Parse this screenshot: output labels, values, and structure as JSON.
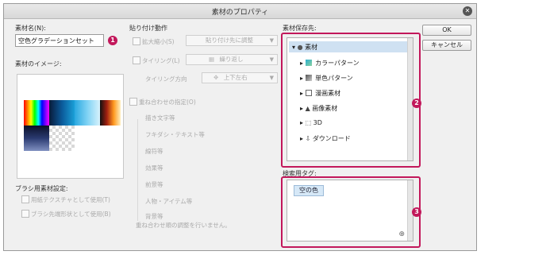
{
  "window": {
    "title": "素材のプロパティ"
  },
  "left": {
    "name_label": "素材名(N):",
    "name_value": "空色グラデーションセット",
    "image_label": "素材のイメージ:",
    "brush_label": "ブラシ用素材設定:",
    "brush_options": [
      "用紙テクスチャとして使用(T)",
      "ブラシ先端形状として使用(B)"
    ]
  },
  "paste": {
    "header": "貼り付け動作",
    "scale_label": "拡大縮小(S)",
    "scale_value": "貼り付け先に調整",
    "tiling_label": "タイリング(L)",
    "tiling_value": "繰り返し",
    "tiling_dir_label": "タイリング方向",
    "tiling_dir_value": "上下左右",
    "overlap_label": "重ね合わせの指定(O)",
    "overlap_items": [
      "描き文字等",
      "フキダシ・テキスト等",
      "線符等",
      "効果等",
      "前景等",
      "人物・アイテム等",
      "背景等"
    ],
    "overlap_note": "重ね合わせ順の調整を行いません。"
  },
  "save": {
    "label": "素材保存先:",
    "tree": [
      {
        "label": "素材",
        "icon": "folder-icon"
      },
      {
        "label": "カラーパターン",
        "icon": "color-pattern-icon"
      },
      {
        "label": "単色パターン",
        "icon": "mono-pattern-icon"
      },
      {
        "label": "漫画素材",
        "icon": "manga-icon"
      },
      {
        "label": "画像素材",
        "icon": "image-icon"
      },
      {
        "label": "3D",
        "icon": "cube-icon"
      },
      {
        "label": "ダウンロード",
        "icon": "download-icon"
      }
    ]
  },
  "tags": {
    "label": "検索用タグ:",
    "items": [
      "空の色"
    ]
  },
  "buttons": {
    "ok": "OK",
    "cancel": "キャンセル"
  },
  "markers": [
    "1",
    "2",
    "3"
  ],
  "colors": {
    "highlight": "#c2185b",
    "selection": "#cfe1f2",
    "tag": "#d6e8f7"
  }
}
